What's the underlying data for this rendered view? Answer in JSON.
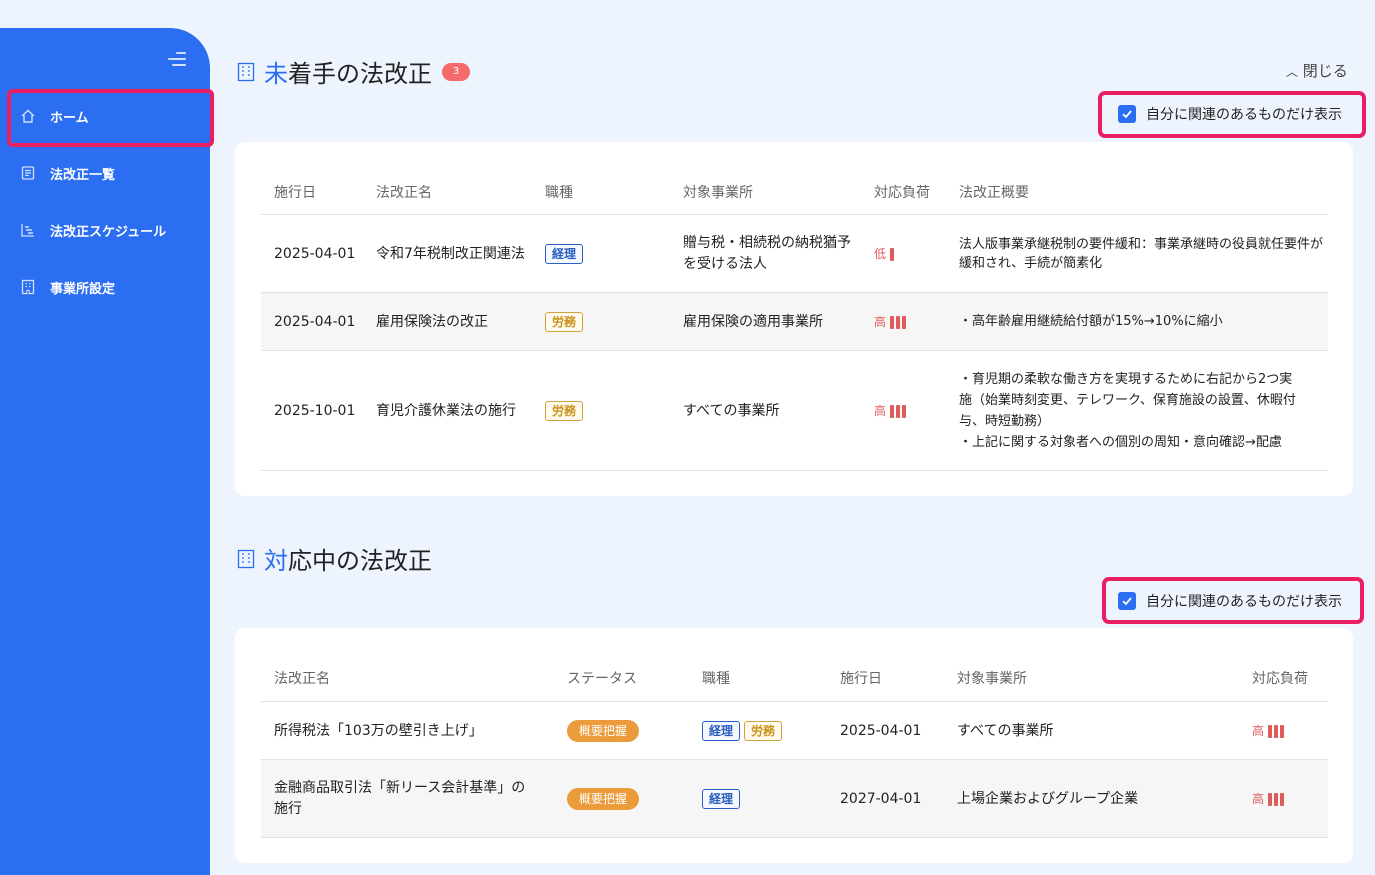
{
  "sidebar": {
    "items": [
      {
        "label": "ホーム"
      },
      {
        "label": "法改正一覧"
      },
      {
        "label": "法改正スケジュール"
      },
      {
        "label": "事業所設定"
      }
    ]
  },
  "pending": {
    "title_accent": "未",
    "title_rest": "着手の法改正",
    "count": "3",
    "close_label": "閉じる",
    "filter_label": "自分に関連のあるものだけ表示",
    "headers": [
      "施行日",
      "法改正名",
      "職種",
      "対象事業所",
      "対応負荷",
      "法改正概要"
    ],
    "rows": [
      {
        "date": "2025-04-01",
        "name": "令和7年税制改正関連法",
        "tags": [
          "経理"
        ],
        "office": "贈与税・相続税の納税猶予を受ける法人",
        "load": "低",
        "load_level": 1,
        "summary": "法人版事業承継税制の要件緩和：事業承継時の役員就任要件が緩和され、手続が簡素化"
      },
      {
        "date": "2025-04-01",
        "name": "雇用保険法の改正",
        "tags": [
          "労務"
        ],
        "office": "雇用保険の適用事業所",
        "load": "高",
        "load_level": 3,
        "summary": "・高年齢雇用継続給付額が15%→10%に縮小"
      },
      {
        "date": "2025-10-01",
        "name": "育児介護休業法の施行",
        "tags": [
          "労務"
        ],
        "office": "すべての事業所",
        "load": "高",
        "load_level": 3,
        "summary_lines": [
          "・育児期の柔軟な働き方を実現するために右記から2つ実",
          "施（始業時刻変更、テレワーク、保育施設の設置、休暇付",
          "与、時短勤務）",
          "・上記に関する対象者への個別の周知・意向確認→配慮"
        ]
      }
    ]
  },
  "inprogress": {
    "title_accent": "対",
    "title_rest": "応中の法改正",
    "filter_label": "自分に関連のあるものだけ表示",
    "headers": [
      "法改正名",
      "ステータス",
      "職種",
      "施行日",
      "対象事業所",
      "対応負荷"
    ],
    "rows": [
      {
        "name": "所得税法「103万の壁引き上げ」",
        "status": "概要把握",
        "tags": [
          "経理",
          "労務"
        ],
        "date": "2025-04-01",
        "office": "すべての事業所",
        "load": "高",
        "load_level": 3
      },
      {
        "name_lines": [
          "金融商品取引法「新リース会計基準」の",
          "施行"
        ],
        "status": "概要把握",
        "tags": [
          "経理"
        ],
        "date": "2027-04-01",
        "office": "上場企業およびグループ企業",
        "load": "高",
        "load_level": 3
      }
    ]
  },
  "colors": {
    "primary": "#2b6ef2",
    "highlight": "#ea1f63",
    "load_red": "#e05a5a",
    "status_orange": "#eb9b3a"
  },
  "icons": [
    "menu-collapse-icon",
    "home-icon",
    "list-icon",
    "schedule-icon",
    "office-icon",
    "chevron-up-icon",
    "checkbox-checked-icon",
    "building-icon"
  ]
}
